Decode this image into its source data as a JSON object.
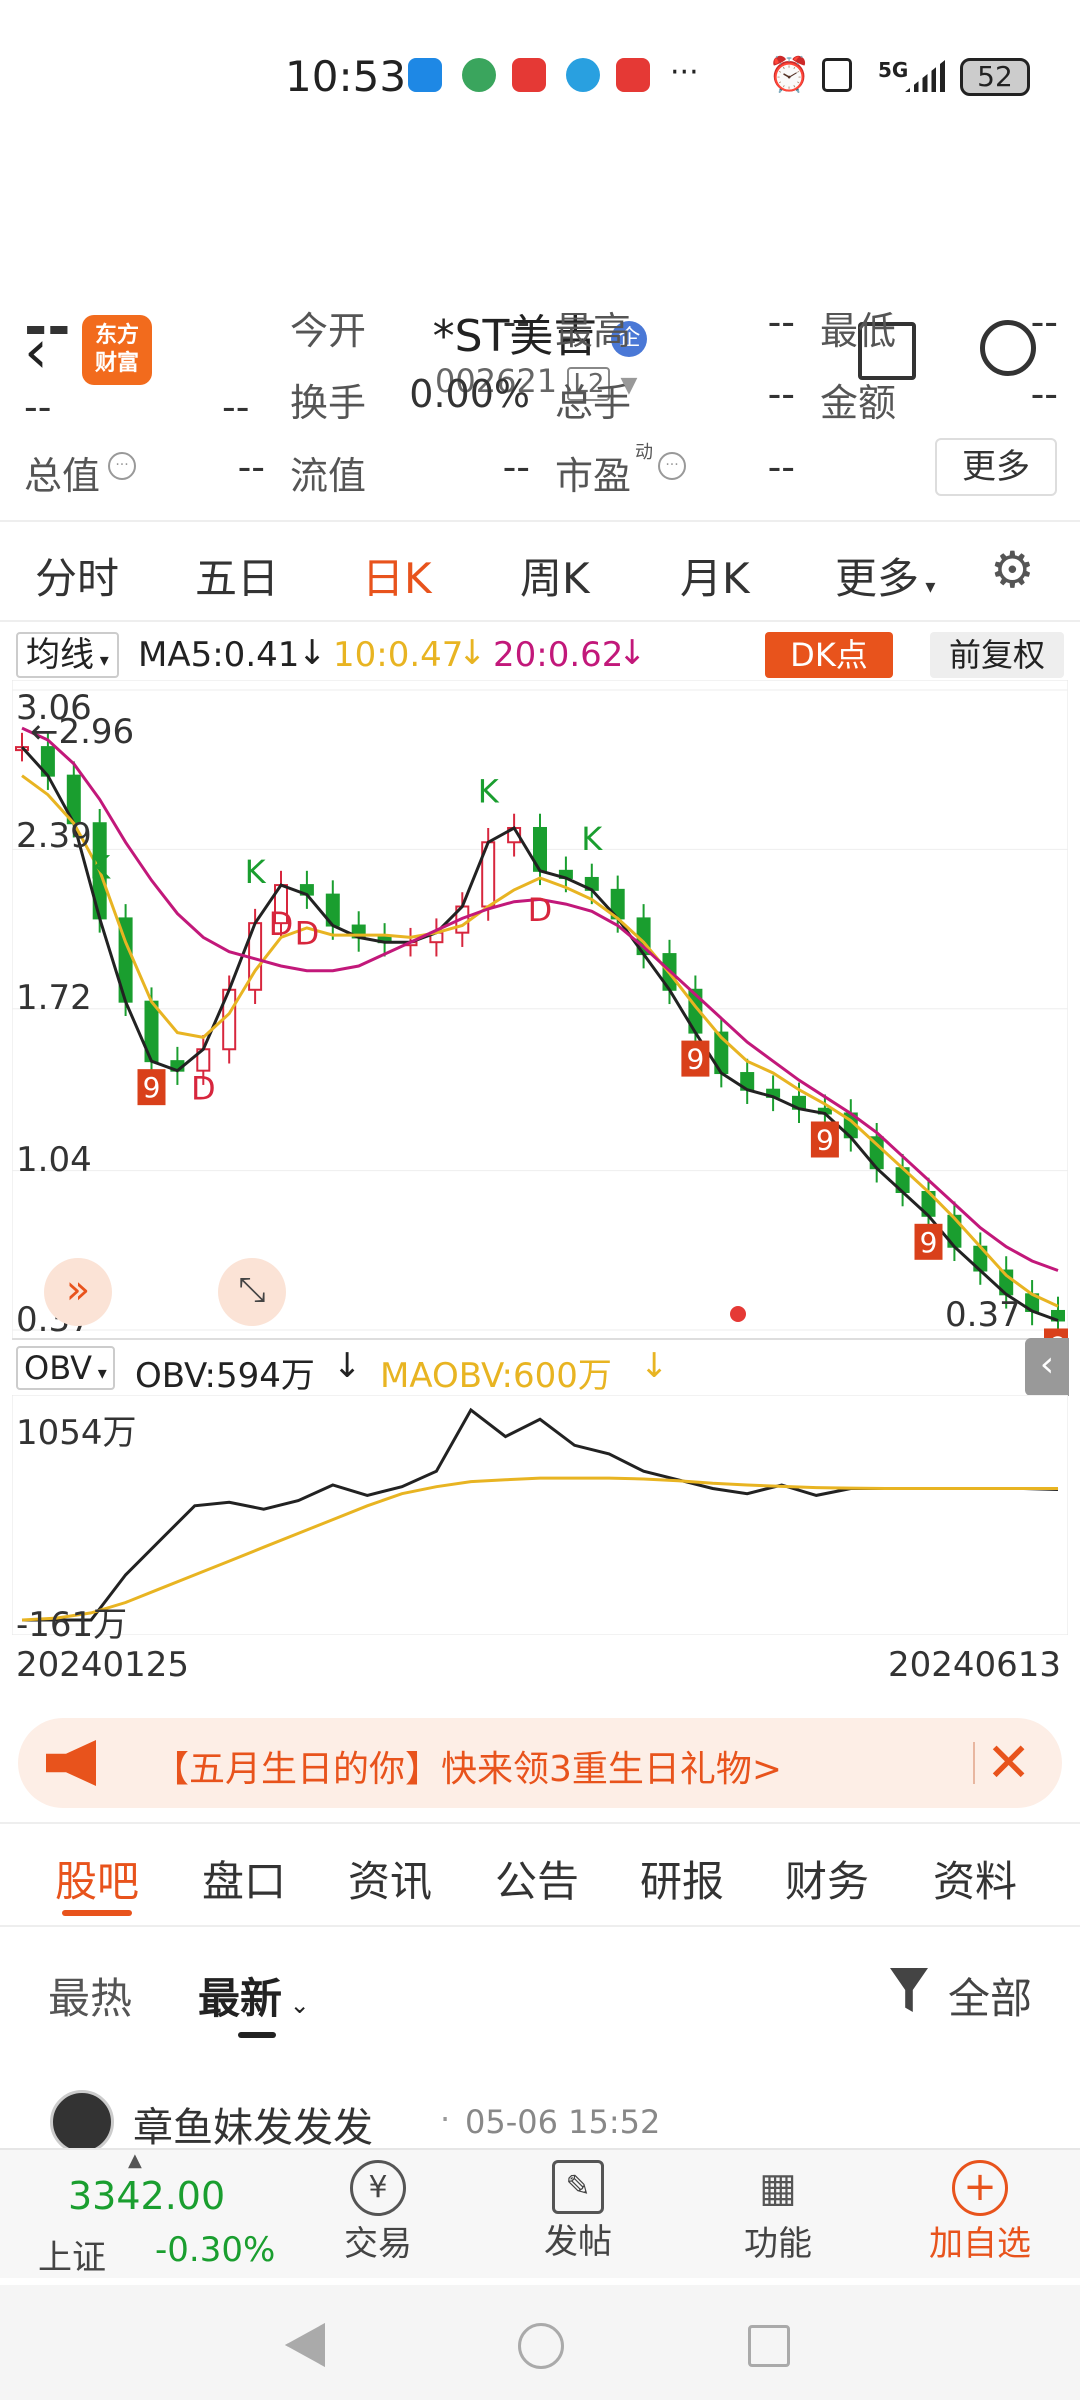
{
  "status": {
    "time": "10:53",
    "battery": "52",
    "network": "5G"
  },
  "header": {
    "title": "*ST美吉",
    "badge": "企",
    "code": "002621",
    "level": "L2",
    "logo": "东方\n财富"
  },
  "quote": {
    "price": "--",
    "change1": "--",
    "change2": "--",
    "items": [
      {
        "label": "今开",
        "value": "--"
      },
      {
        "label": "最高",
        "value": "--"
      },
      {
        "label": "最低",
        "value": "--"
      },
      {
        "label": "换手",
        "value": "0.00%"
      },
      {
        "label": "总手",
        "value": "--"
      },
      {
        "label": "金额",
        "value": "--"
      },
      {
        "label": "总值",
        "value": "--"
      },
      {
        "label": "流值",
        "value": "--"
      },
      {
        "label": "市盈",
        "value": "--"
      }
    ],
    "pe_superscript": "动",
    "more_label": "更多"
  },
  "period_tabs": [
    "分时",
    "五日",
    "日K",
    "周K",
    "月K",
    "更多"
  ],
  "active_period": "日K",
  "chart_toolbar": {
    "ma_select": "均线",
    "ma5": "MA5:0.41",
    "ma10": "10:0.47",
    "ma20": "20:0.62",
    "dk_label": "DK点",
    "adjust_label": "前复权"
  },
  "colors": {
    "accent": "#e8531c",
    "ma5": "#222222",
    "ma10": "#e8b422",
    "ma20": "#c2187a",
    "up": "#d7263d",
    "down": "#1a9e2f"
  },
  "chart_data": {
    "type": "line",
    "ylim": [
      0.37,
      3.06
    ],
    "y_ticks": [
      "3.06",
      "2.39",
      "1.72",
      "1.04",
      "0.37"
    ],
    "high_label": "←2.96",
    "low_label": "0.37",
    "x_labels": [
      "20240125",
      "20240613"
    ],
    "series": [
      {
        "name": "MA5",
        "values": [
          2.82,
          2.7,
          2.5,
          2.1,
          1.75,
          1.5,
          1.46,
          1.55,
          1.8,
          2.08,
          2.24,
          2.2,
          2.07,
          2.02,
          2.0,
          2.0,
          2.04,
          2.15,
          2.42,
          2.48,
          2.3,
          2.27,
          2.22,
          2.1,
          1.95,
          1.8,
          1.62,
          1.45,
          1.38,
          1.35,
          1.3,
          1.28,
          1.18,
          1.05,
          0.95,
          0.85,
          0.72,
          0.62,
          0.52,
          0.45,
          0.41
        ]
      },
      {
        "name": "10",
        "values": [
          2.7,
          2.62,
          2.5,
          2.3,
          2.0,
          1.75,
          1.62,
          1.6,
          1.7,
          1.88,
          2.02,
          2.06,
          2.03,
          2.03,
          2.03,
          2.02,
          2.04,
          2.07,
          2.15,
          2.22,
          2.27,
          2.23,
          2.18,
          2.1,
          2.0,
          1.87,
          1.73,
          1.6,
          1.5,
          1.45,
          1.38,
          1.32,
          1.25,
          1.15,
          1.05,
          0.95,
          0.84,
          0.72,
          0.6,
          0.52,
          0.47
        ]
      },
      {
        "name": "20",
        "values": [
          2.9,
          2.85,
          2.75,
          2.6,
          2.42,
          2.26,
          2.12,
          2.02,
          1.96,
          1.93,
          1.9,
          1.88,
          1.88,
          1.9,
          1.95,
          2.0,
          2.05,
          2.1,
          2.14,
          2.17,
          2.18,
          2.16,
          2.13,
          2.07,
          1.98,
          1.88,
          1.78,
          1.68,
          1.58,
          1.5,
          1.42,
          1.35,
          1.28,
          1.2,
          1.1,
          1.0,
          0.9,
          0.8,
          0.72,
          0.66,
          0.62
        ]
      }
    ],
    "signals": [
      "K",
      "K",
      "K",
      "K",
      "D",
      "D",
      "D",
      "D",
      "9",
      "9",
      "9",
      "9",
      "9"
    ]
  },
  "obv": {
    "select": "OBV",
    "obv_label": "OBV:594万",
    "maobv_label": "MAOBV:600万",
    "y_top": "1054万",
    "y_bottom": "-161万",
    "obv_values": [
      -161,
      -161,
      -161,
      100,
      300,
      500,
      520,
      480,
      530,
      620,
      560,
      610,
      700,
      1054,
      900,
      1000,
      850,
      800,
      700,
      650,
      600,
      570,
      620,
      560,
      600,
      600,
      600,
      600,
      600,
      600,
      594
    ],
    "maobv_values": [
      -161,
      -150,
      -120,
      -60,
      20,
      100,
      180,
      260,
      340,
      420,
      500,
      570,
      610,
      640,
      650,
      660,
      660,
      660,
      655,
      645,
      630,
      620,
      612,
      605,
      602,
      600,
      600,
      600,
      600,
      600,
      600
    ]
  },
  "banner": {
    "text": "【五月生日的你】快来领3重生日礼物>"
  },
  "sub_tabs": [
    "股吧",
    "盘口",
    "资讯",
    "公告",
    "研报",
    "财务",
    "资料"
  ],
  "active_sub_tab": "股吧",
  "sort": {
    "hot": "最热",
    "new": "最新",
    "filter": "全部"
  },
  "post": {
    "author": "章鱼妹发发发",
    "time": "05-06 15:52"
  },
  "bottom": {
    "index_value": "3342.00",
    "index_name": "上证",
    "index_change": "-0.30%",
    "buttons": [
      {
        "label": "交易",
        "icon": "yen-icon"
      },
      {
        "label": "发帖",
        "icon": "edit-icon"
      },
      {
        "label": "功能",
        "icon": "grid-icon"
      },
      {
        "label": "加自选",
        "icon": "plus-circle-icon"
      }
    ]
  }
}
